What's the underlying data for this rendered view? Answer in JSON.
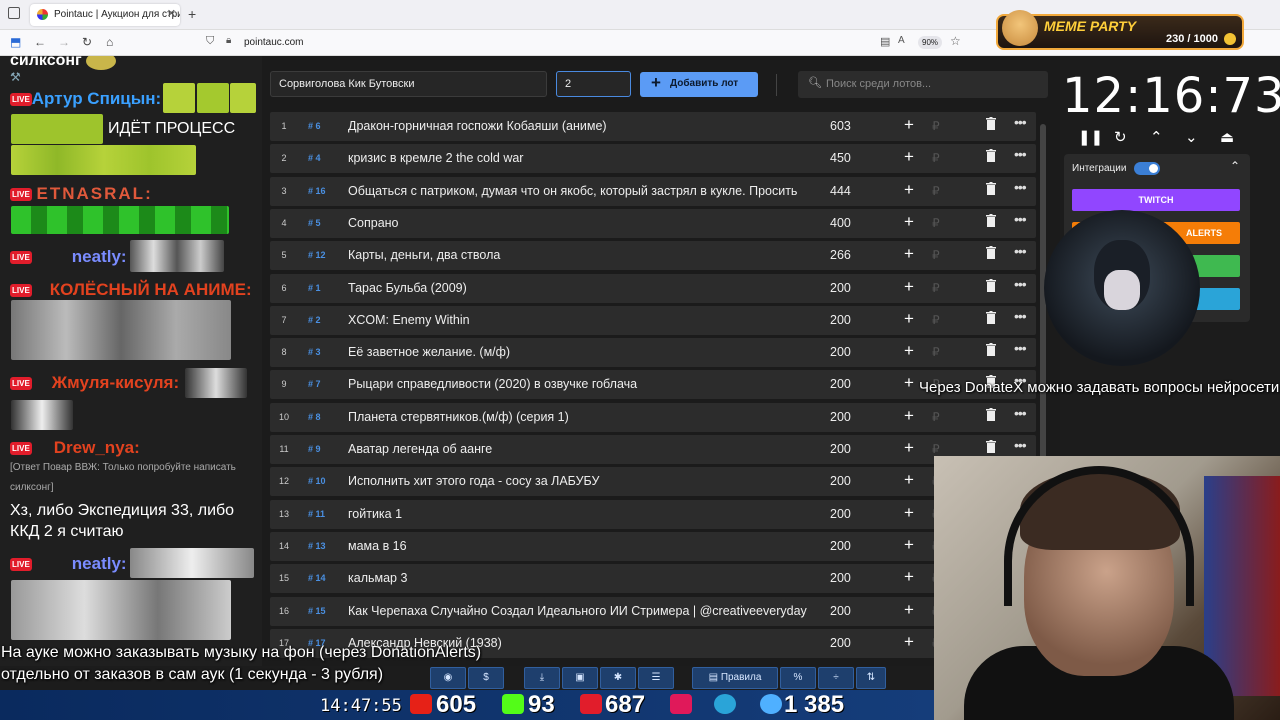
{
  "browser": {
    "tab_title": "Pointauc | Аукцион для стриме",
    "url": "pointauc.com",
    "zoom": "90%"
  },
  "meme_party": {
    "title": "MEME PARTY",
    "score": "230 / 1000"
  },
  "chat": {
    "top_fragment": "силксонг",
    "users": [
      {
        "name": "Артур Спицын:",
        "color": "#3aa0ff"
      },
      {
        "name": "ETNASRAL:",
        "color": "#e0593b"
      },
      {
        "name": "neatly:",
        "color": "#7a8cff"
      },
      {
        "name": "КОЛЁСНЫЙ НА АНИМЕ:",
        "color": "#e2421f"
      },
      {
        "name": "Жмуля-кисуля:",
        "color": "#e2421f"
      },
      {
        "name": "Drew_nya:",
        "color": "#e2421f"
      },
      {
        "name": "neatly:",
        "color": "#7a8cff"
      }
    ],
    "msg_process": "ИДЁТ ПРОЦЕСС",
    "reply": "[Ответ Повар ВВЖ: Только попробуйте написать силксонг]",
    "drew_msg": "Хз, либо Экспедиция 33, либо ККД 2 я считаю"
  },
  "auction": {
    "lot_name_value": "Сорвиголова Кик Бутовски",
    "amount_value": "2",
    "add_lot_label": "Добавить лот",
    "search_placeholder": "Поиск среди лотов...",
    "lots": [
      {
        "num": "1",
        "id": "# 6",
        "name": "Дракон-горничная госпожи Кобаяши (аниме)",
        "amount": "603"
      },
      {
        "num": "2",
        "id": "# 4",
        "name": "кризис в кремле 2 the cold war",
        "amount": "450"
      },
      {
        "num": "3",
        "id": "# 16",
        "name": "Общаться с патриком, думая что он якобс, который застрял в кукле. Просить",
        "amount": "444"
      },
      {
        "num": "4",
        "id": "# 5",
        "name": "Сопрано",
        "amount": "400"
      },
      {
        "num": "5",
        "id": "# 12",
        "name": "Карты, деньги, два ствола",
        "amount": "266"
      },
      {
        "num": "6",
        "id": "# 1",
        "name": "Тарас Бульба (2009)",
        "amount": "200"
      },
      {
        "num": "7",
        "id": "# 2",
        "name": "XCOM: Enemy Within",
        "amount": "200"
      },
      {
        "num": "8",
        "id": "# 3",
        "name": "Её заветное желание. (м/ф)",
        "amount": "200"
      },
      {
        "num": "9",
        "id": "# 7",
        "name": "Рыцари справедливости (2020) в озвучке гоблача",
        "amount": "200"
      },
      {
        "num": "10",
        "id": "# 8",
        "name": "Планета стервятников.(м/ф) (серия 1)",
        "amount": "200"
      },
      {
        "num": "11",
        "id": "# 9",
        "name": "Аватар легенда об аанге",
        "amount": "200"
      },
      {
        "num": "12",
        "id": "# 10",
        "name": "Исполнить хит этого года - сосу за ЛАБУБУ",
        "amount": "200"
      },
      {
        "num": "13",
        "id": "# 11",
        "name": "гойтика 1",
        "amount": "200"
      },
      {
        "num": "14",
        "id": "# 13",
        "name": "мама в 16",
        "amount": "200"
      },
      {
        "num": "15",
        "id": "# 14",
        "name": "кальмар 3",
        "amount": "200"
      },
      {
        "num": "16",
        "id": "# 15",
        "name": "Как Черепаха Случайно Создал Идеального ИИ Стримера | @creativeeveryday",
        "amount": "200"
      },
      {
        "num": "17",
        "id": "# 17",
        "name": "Александр Невский (1938)",
        "amount": "200"
      }
    ],
    "timer": "12:16:73",
    "integrations_label": "Интеграции",
    "twitch_label": "TWITCH",
    "alerts_label": "ALERTS"
  },
  "overlay": {
    "donatex_text": "Через DonateX можно задавать вопросы нейросети",
    "music_line1": "На ауке можно заказывать музыку на фон (через DonationAlerts)",
    "music_line2": "отдельно от заказов в сам аук (1 секунда - 3 рубля)"
  },
  "toolbar": {
    "rules_label": "Правила",
    "percent_label": "%"
  },
  "stats": {
    "clock": "14:47:55",
    "youtube": "605",
    "kick": "93",
    "vk": "687",
    "rutube": "",
    "followers": "1 385"
  },
  "colors": {
    "accent_blue": "#5b9bf5",
    "twitch": "#9146ff",
    "alerts": "#f57d07",
    "green": "#3fb950",
    "cyan": "#2aa4d8"
  }
}
